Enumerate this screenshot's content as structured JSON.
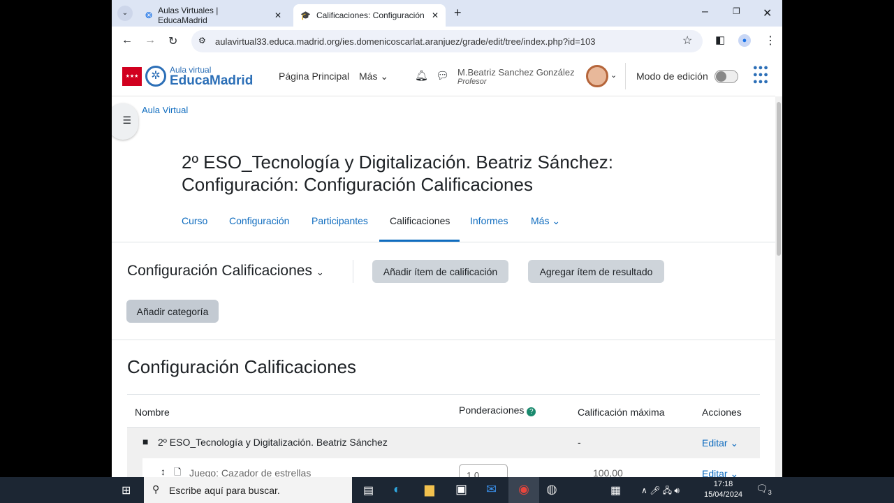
{
  "browser": {
    "tabs": [
      {
        "title": "Aulas Virtuales | EducaMadrid"
      },
      {
        "title": "Calificaciones: Configuración"
      }
    ],
    "url": "aulavirtual33.educa.madrid.org/ies.domenicoscarlat.aranjuez/grade/edit/tree/index.php?id=103"
  },
  "header": {
    "logo_top": "Aula virtual",
    "logo_bottom": "EducaMadrid",
    "nav": [
      "Página Principal",
      "Más"
    ],
    "user_name": "M.Beatriz Sanchez González",
    "user_role": "Profesor",
    "edit_mode_label": "Modo de edición",
    "edit_mode_on": false
  },
  "breadcrumb": "Aula Virtual",
  "page_title": "2º ESO_Tecnología y Digitalización. Beatriz Sánchez: Configuración: Configuración Calificaciones",
  "secondary_nav": [
    "Curso",
    "Configuración",
    "Participantes",
    "Calificaciones",
    "Informes",
    "Más"
  ],
  "action_bar": {
    "selector": "Configuración Calificaciones",
    "add_item": "Añadir ítem de calificación",
    "add_outcome": "Agregar ítem de resultado",
    "add_category": "Añadir categoría"
  },
  "section_title": "Configuración Calificaciones",
  "table": {
    "headers": [
      "Nombre",
      "Ponderaciones",
      "Calificación máxima",
      "Acciones"
    ],
    "rows": [
      {
        "name": "2º ESO_Tecnología y Digitalización. Beatriz Sánchez",
        "max": "-",
        "action": "Editar"
      },
      {
        "name": "Juego: Cazador de estrellas",
        "weight": "1,0",
        "max": "100,00",
        "action": "Editar"
      }
    ]
  },
  "taskbar": {
    "search_placeholder": "Escribe aquí para buscar.",
    "time": "17:18",
    "date": "15/04/2024",
    "notifications": "3"
  }
}
